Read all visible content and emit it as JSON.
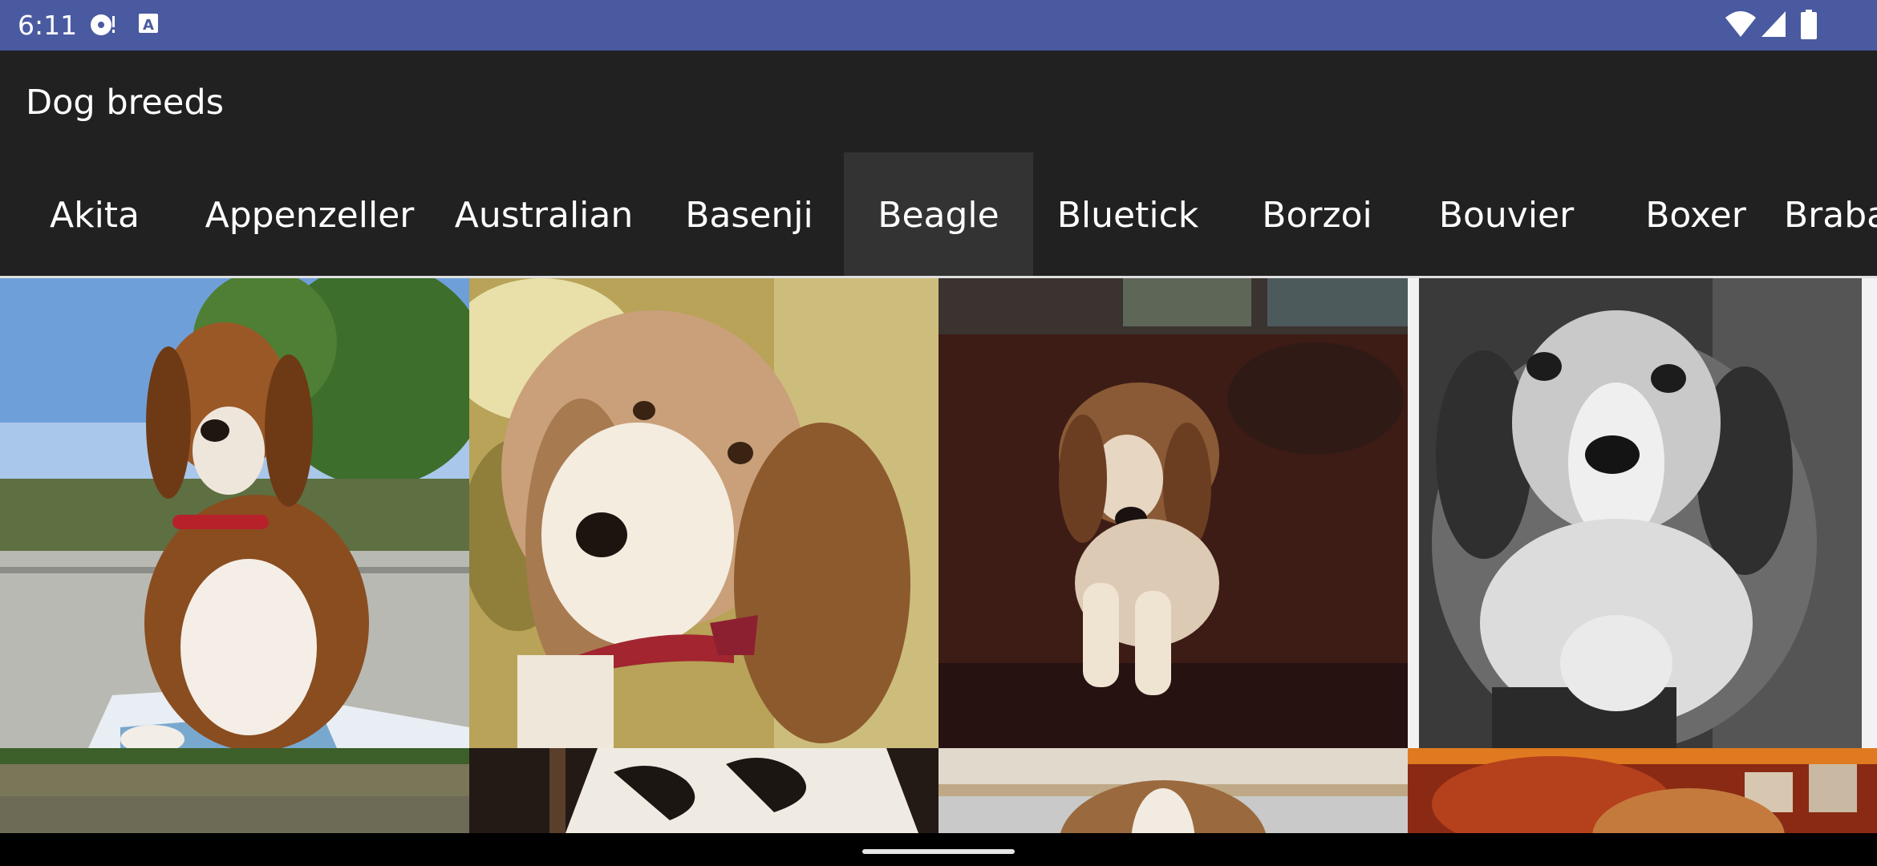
{
  "status_bar": {
    "time": "6:11",
    "left_icons": [
      "media-sync-icon",
      "keyboard-a-icon"
    ],
    "right_icons": [
      "wifi-icon",
      "cellular-signal-icon",
      "battery-icon"
    ]
  },
  "app_bar": {
    "title": "Dog breeds"
  },
  "tabs": [
    {
      "label": "Akita"
    },
    {
      "label": "Appenzeller"
    },
    {
      "label": "Australian"
    },
    {
      "label": "Basenji"
    },
    {
      "label": "Beagle"
    },
    {
      "label": "Bluetick"
    },
    {
      "label": "Borzoi"
    },
    {
      "label": "Bouvier"
    },
    {
      "label": "Boxer"
    },
    {
      "label": "Brabancon"
    }
  ],
  "selected_tab": "Beagle",
  "photos": [
    {
      "name": "beagle-photo-outdoor-newspaper"
    },
    {
      "name": "beagle-photo-sunlit-closeup"
    },
    {
      "name": "beagle-photo-dark-room-lying"
    },
    {
      "name": "beagle-photo-black-and-white"
    },
    {
      "name": "beagle-photo-grass"
    },
    {
      "name": "beagle-photo-cushion"
    },
    {
      "name": "beagle-photo-head-top"
    },
    {
      "name": "beagle-photo-red-sofa"
    }
  ],
  "colors": {
    "status_bar": "#4a5aa0",
    "app_background": "#212121",
    "selected_tab": "#333333",
    "text": "#ffffff"
  }
}
